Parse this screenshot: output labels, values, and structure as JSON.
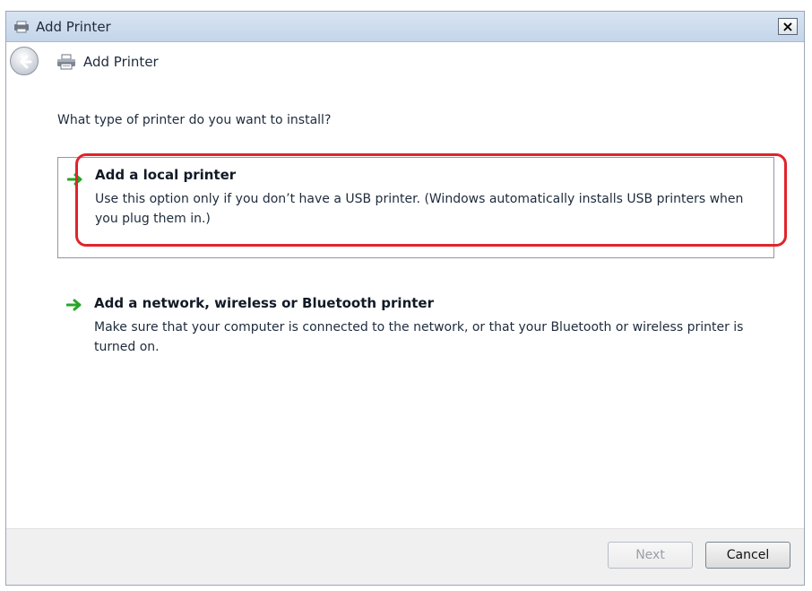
{
  "window": {
    "title": "Add Printer",
    "close_label": "×"
  },
  "nav": {
    "title": "Add Printer"
  },
  "main": {
    "question": "What type of printer do you want to install?",
    "options": [
      {
        "title": "Add a local printer",
        "description": "Use this option only if you don’t have a USB printer. (Windows automatically installs USB printers when you plug them in.)",
        "highlighted": true
      },
      {
        "title": "Add a network, wireless or Bluetooth printer",
        "description": "Make sure that your computer is connected to the network, or that your Bluetooth or wireless printer is turned on.",
        "highlighted": false
      }
    ]
  },
  "footer": {
    "next_label": "Next",
    "next_enabled": false,
    "cancel_label": "Cancel"
  },
  "colors": {
    "highlight": "#e0242b",
    "arrow": "#2aa52a",
    "titlebar": "#c4d5ea"
  },
  "icons": {
    "title": "printer-icon",
    "back": "back-arrow-icon",
    "nav": "printer-icon",
    "option": "green-arrow-icon"
  }
}
